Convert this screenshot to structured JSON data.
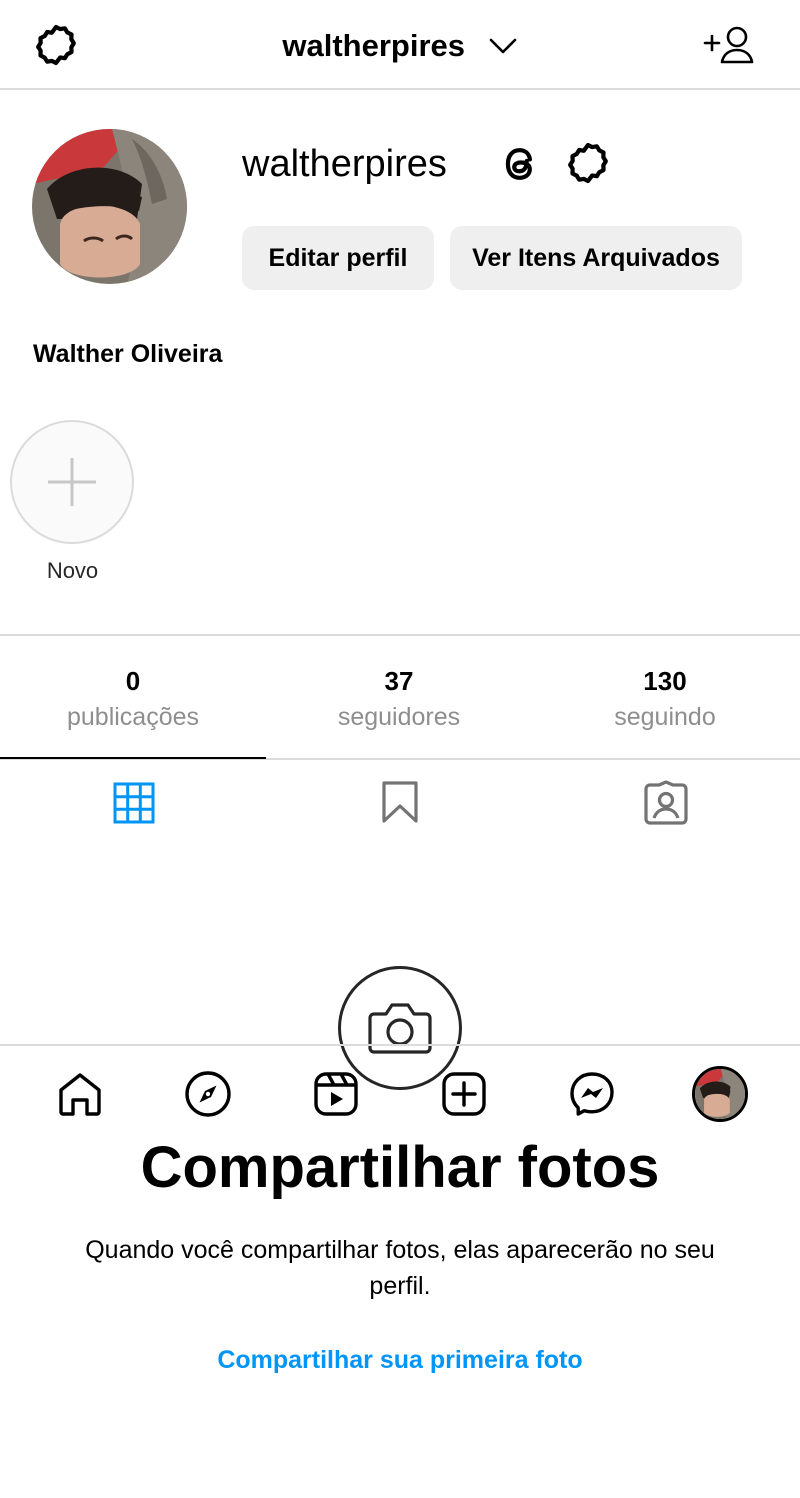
{
  "header": {
    "username": "waltherpires",
    "icons": {
      "settings": "gear-icon",
      "dropdown": "chevron-down-icon",
      "add_user": "add-user-icon"
    }
  },
  "profile": {
    "username": "waltherpires",
    "edit_button": "Editar perfil",
    "archive_button": "Ver Itens Arquivados",
    "full_name": "Walther Oliveira",
    "icons": {
      "threads": "threads-icon",
      "options": "gear-icon"
    }
  },
  "highlights": {
    "new_label": "Novo"
  },
  "stats": [
    {
      "value": "0",
      "label": "publicações"
    },
    {
      "value": "37",
      "label": "seguidores"
    },
    {
      "value": "130",
      "label": "seguindo"
    }
  ],
  "tabs": [
    "grid-icon",
    "bookmark-icon",
    "tagged-icon"
  ],
  "empty_state": {
    "title": "Compartilhar fotos",
    "description": "Quando você compartilhar fotos, elas aparecerão no seu perfil.",
    "link": "Compartilhar sua primeira foto"
  },
  "bottom_nav": [
    "home-icon",
    "explore-icon",
    "reels-icon",
    "new-post-icon",
    "messenger-icon",
    "profile-avatar"
  ],
  "colors": {
    "accent": "#0095f6",
    "border": "#dbdbdb",
    "button_bg": "#efefef",
    "muted": "#8e8e8e"
  }
}
